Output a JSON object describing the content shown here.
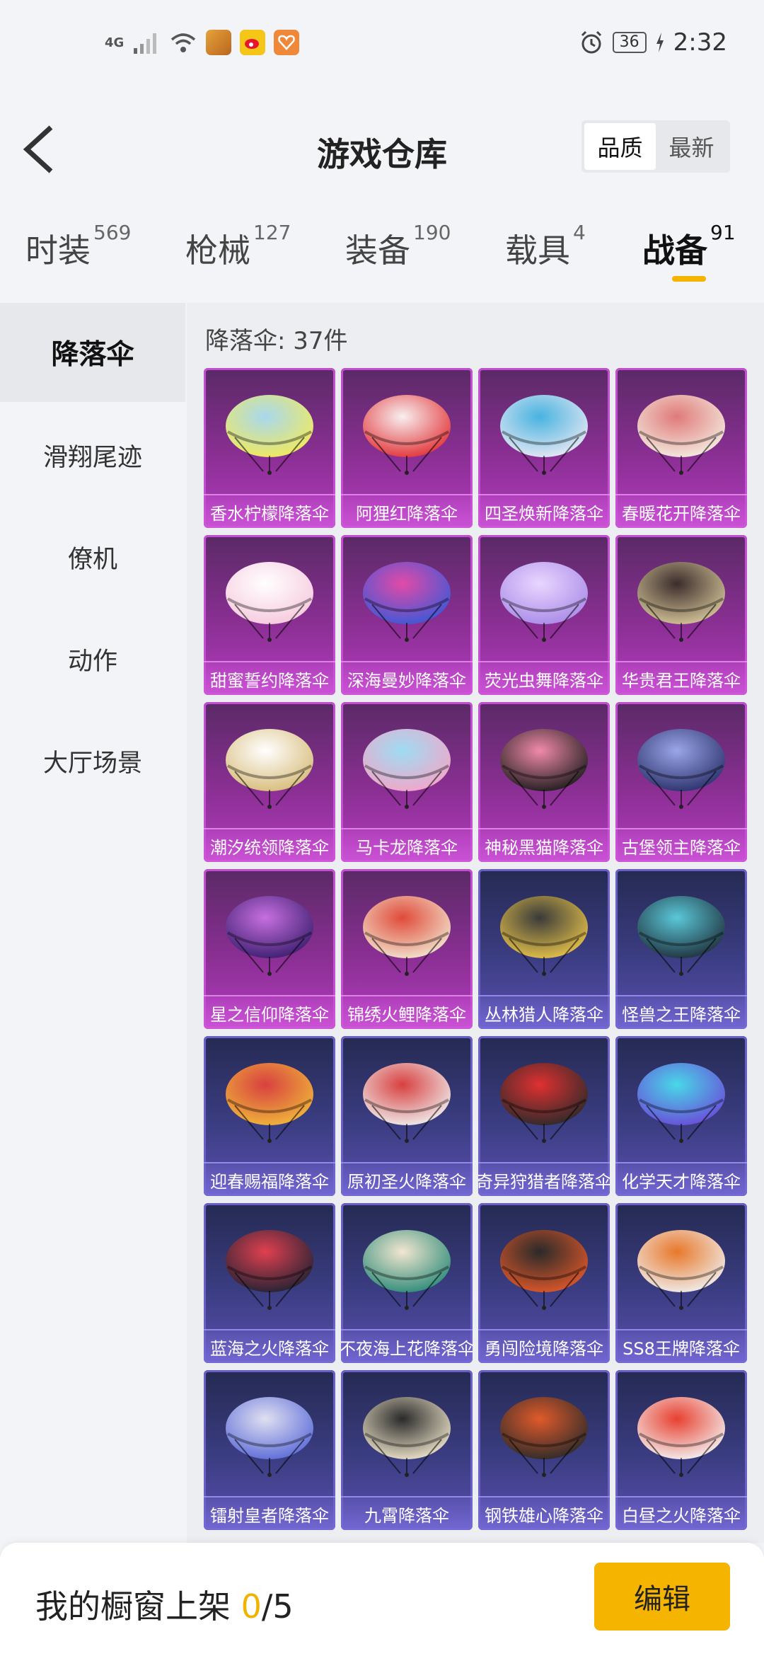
{
  "status_bar": {
    "network": "4G",
    "battery": "36",
    "time": "2:32",
    "icons": [
      "signal-icon",
      "wifi-icon",
      "game-app-icon",
      "weibo-icon",
      "health-app-icon",
      "alarm-icon",
      "charging-icon"
    ]
  },
  "header": {
    "title": "游戏仓库",
    "sort_options": [
      {
        "label": "品质",
        "selected": true
      },
      {
        "label": "最新",
        "selected": false
      }
    ]
  },
  "tabs": [
    {
      "label": "时装",
      "count": "569",
      "active": false
    },
    {
      "label": "枪械",
      "count": "127",
      "active": false
    },
    {
      "label": "装备",
      "count": "190",
      "active": false
    },
    {
      "label": "载具",
      "count": "4",
      "active": false
    },
    {
      "label": "战备",
      "count": "91",
      "active": true
    }
  ],
  "sidebar": {
    "items": [
      {
        "label": "降落伞",
        "active": true
      },
      {
        "label": "滑翔尾迹",
        "active": false
      },
      {
        "label": "僚机",
        "active": false
      },
      {
        "label": "动作",
        "active": false
      },
      {
        "label": "大厅场景",
        "active": false
      }
    ]
  },
  "content": {
    "count_label": "降落伞: 37件",
    "items": [
      {
        "name": "香水柠檬降落伞",
        "tier": "purple",
        "colors": [
          "#f2ea5a",
          "#a8d8ef"
        ]
      },
      {
        "name": "阿狸红降落伞",
        "tier": "purple",
        "colors": [
          "#e23035",
          "#f7f0f0"
        ]
      },
      {
        "name": "四圣焕新降落伞",
        "tier": "purple",
        "colors": [
          "#e9e9f4",
          "#48b3e0"
        ]
      },
      {
        "name": "春暖花开降落伞",
        "tier": "purple",
        "colors": [
          "#f4eee2",
          "#e07a7a"
        ]
      },
      {
        "name": "甜蜜誓约降落伞",
        "tier": "purple",
        "colors": [
          "#f6c8dc",
          "#ffffff"
        ]
      },
      {
        "name": "深海曼妙降落伞",
        "tier": "purple",
        "colors": [
          "#3a58d8",
          "#e24aa8"
        ]
      },
      {
        "name": "荧光虫舞降落伞",
        "tier": "purple",
        "colors": [
          "#a98ae8",
          "#e9d6ff"
        ]
      },
      {
        "name": "华贵君王降落伞",
        "tier": "purple",
        "colors": [
          "#d7c79a",
          "#3b2c2c"
        ]
      },
      {
        "name": "潮汐统领降落伞",
        "tier": "purple",
        "colors": [
          "#d7bb78",
          "#ffffff"
        ]
      },
      {
        "name": "马卡龙降落伞",
        "tier": "purple",
        "colors": [
          "#f3a5c8",
          "#9fdcf2"
        ]
      },
      {
        "name": "神秘黑猫降落伞",
        "tier": "purple",
        "colors": [
          "#1a1a1a",
          "#f08aaa"
        ]
      },
      {
        "name": "古堡领主降落伞",
        "tier": "purple",
        "colors": [
          "#2a2f6a",
          "#9aa6e8"
        ]
      },
      {
        "name": "星之信仰降落伞",
        "tier": "purple",
        "colors": [
          "#3a1d6e",
          "#c76fe0"
        ]
      },
      {
        "name": "锦绣火鲤降落伞",
        "tier": "purple",
        "colors": [
          "#f2e6d0",
          "#e04a3a"
        ]
      },
      {
        "name": "丛林猎人降落伞",
        "tier": "blue",
        "colors": [
          "#e8c44a",
          "#3a3a3a"
        ]
      },
      {
        "name": "怪兽之王降落伞",
        "tier": "blue",
        "colors": [
          "#1f2e3a",
          "#5ac8d8"
        ]
      },
      {
        "name": "迎春赐福降落伞",
        "tier": "blue",
        "colors": [
          "#f0b83a",
          "#d84040"
        ]
      },
      {
        "name": "原初圣火降落伞",
        "tier": "blue",
        "colors": [
          "#f0f0f0",
          "#d84040"
        ]
      },
      {
        "name": "奇异狩猎者降落伞",
        "tier": "blue",
        "colors": [
          "#2a2a2a",
          "#e03030"
        ]
      },
      {
        "name": "化学天才降落伞",
        "tier": "blue",
        "colors": [
          "#6a4ad8",
          "#48d8e8"
        ]
      },
      {
        "name": "蓝海之火降落伞",
        "tier": "blue",
        "colors": [
          "#1f2233",
          "#e04050"
        ]
      },
      {
        "name": "不夜海上花降落伞",
        "tier": "blue",
        "colors": [
          "#2a8a78",
          "#f2e6d0"
        ]
      },
      {
        "name": "勇闯险境降落伞",
        "tier": "blue",
        "colors": [
          "#e0582a",
          "#2a2a2a"
        ]
      },
      {
        "name": "SS8王牌降落伞",
        "tier": "blue",
        "colors": [
          "#f0f0f0",
          "#e8782a"
        ]
      },
      {
        "name": "镭射皇者降落伞",
        "tier": "blue",
        "colors": [
          "#5a6ad8",
          "#e0e0f0"
        ]
      },
      {
        "name": "九霄降落伞",
        "tier": "blue",
        "colors": [
          "#f0e6cc",
          "#2a2a2a"
        ]
      },
      {
        "name": "钢铁雄心降落伞",
        "tier": "blue",
        "colors": [
          "#2a2a2a",
          "#e05a2a"
        ]
      },
      {
        "name": "白昼之火降落伞",
        "tier": "blue",
        "colors": [
          "#f4f4f4",
          "#e84030"
        ]
      }
    ]
  },
  "bottom_bar": {
    "label": "我的橱窗上架",
    "current": "0",
    "total": "/5",
    "edit_label": "编辑"
  }
}
